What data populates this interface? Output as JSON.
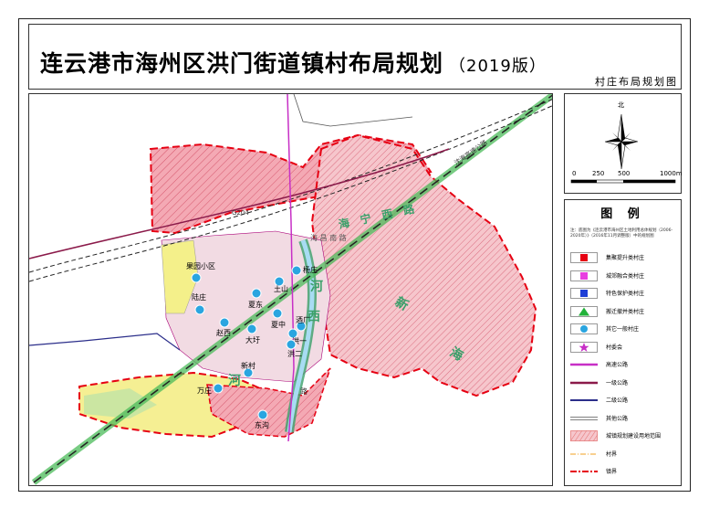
{
  "title": {
    "main": "连云港市海州区洪门街道镇村布局规划",
    "version": "（2019版）",
    "subtitle": "村庄布局规划图"
  },
  "compass": {
    "north": "北"
  },
  "scale": {
    "labels": [
      "0",
      "250",
      "500",
      "1000m"
    ]
  },
  "legend": {
    "title": "图  例",
    "note": "注：底图为《连云港市海州区土地利用总体规划（2006-2020年）》（2016年11月调整版）中的规划图",
    "items": [
      {
        "icon": "red-square-icon",
        "label": "集聚提升类村庄",
        "color": "#e60012"
      },
      {
        "icon": "magenta-square-icon",
        "label": "城郊融合类村庄",
        "color": "#e83ee0"
      },
      {
        "icon": "blue-square-icon",
        "label": "特色保护类村庄",
        "color": "#1f3fd6"
      },
      {
        "icon": "green-triangle-icon",
        "label": "搬迁撤并类村庄",
        "color": "#22b23a"
      },
      {
        "icon": "cyan-circle-icon",
        "label": "其它一般村庄",
        "color": "#2aa5e0"
      },
      {
        "icon": "star-icon",
        "label": "村委会",
        "color": "#c72fc6"
      },
      {
        "icon": "expressway-line-icon",
        "label": "高速公路",
        "color": "#c72fc6"
      },
      {
        "icon": "class1-road-line-icon",
        "label": "一级公路",
        "color": "#8b1a4a"
      },
      {
        "icon": "class2-road-line-icon",
        "label": "二级公路",
        "color": "#2b2e8a"
      },
      {
        "icon": "other-road-line-icon",
        "label": "其他公路",
        "color": "#555555"
      },
      {
        "icon": "hatch-area-icon",
        "label": "城镇规划建设用地范围",
        "color": "#e57a7a"
      },
      {
        "icon": "village-boundary-icon",
        "label": "村界",
        "color": "#f0a020"
      },
      {
        "icon": "town-boundary-icon",
        "label": "镇界",
        "color": "#e60012"
      }
    ]
  },
  "map": {
    "road_labels": {
      "expressway": "沈海高速公路",
      "g204": "G204",
      "haining_road": "海 宁 西 路",
      "haichang_road": "海 昌 南 路",
      "lu": "路",
      "hai_right": "海",
      "xin": "新",
      "he": "河",
      "xi": "西",
      "he2": "河"
    },
    "villages": [
      {
        "name": "果园小区"
      },
      {
        "name": "陆庄"
      },
      {
        "name": "夏东"
      },
      {
        "name": "土山"
      },
      {
        "name": "杨庄"
      },
      {
        "name": "酒厂"
      },
      {
        "name": "夏中"
      },
      {
        "name": "赵西"
      },
      {
        "name": "大圩"
      },
      {
        "name": "洪一"
      },
      {
        "name": "洪二"
      },
      {
        "name": "新村"
      },
      {
        "name": "万庄"
      },
      {
        "name": "东沟"
      }
    ]
  }
}
